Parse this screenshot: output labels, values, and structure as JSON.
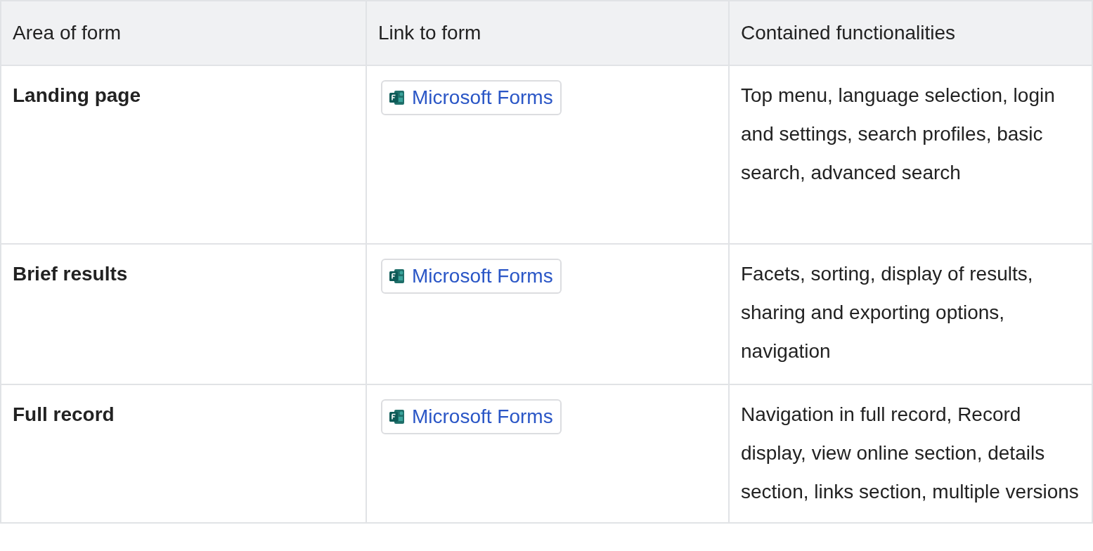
{
  "table": {
    "columns": [
      "Area of form",
      "Link to form",
      "Contained functionalities"
    ],
    "rows": [
      {
        "area": "Landing page",
        "link": "Microsoft Forms",
        "functionalities": "Top menu, language selection, login and settings, search profiles, basic search, advanced search"
      },
      {
        "area": "Brief results",
        "link": "Microsoft Forms",
        "functionalities": "Facets, sorting, display of results, sharing and exporting options, navigation"
      },
      {
        "area": "Full record",
        "link": "Microsoft Forms",
        "functionalities": "Navigation in full record, Record display, view online section, details section, links section, multiple versions"
      }
    ]
  }
}
